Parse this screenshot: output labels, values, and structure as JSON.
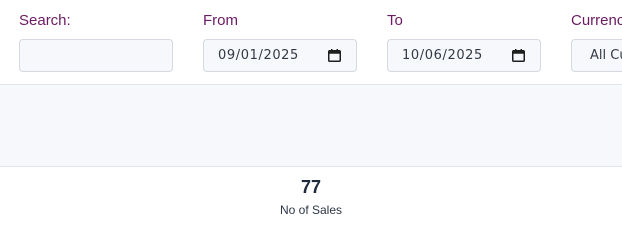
{
  "filters": {
    "search": {
      "label": "Search:",
      "value": ""
    },
    "from": {
      "label": "From",
      "value": "09/01/2025",
      "icon": "calendar-icon"
    },
    "to": {
      "label": "To",
      "value": "10/06/2025",
      "icon": "calendar-icon"
    },
    "currency": {
      "label": "Currency",
      "value": "All Currencies"
    }
  },
  "stats": {
    "sales_count": "77",
    "sales_label": "No of Sales"
  },
  "colors": {
    "label": "#6b1b63",
    "input_background": "#f6f8fb",
    "input_border": "#d6d9df",
    "band_background": "#f7f8fb",
    "stat_text": "#1f2a3d"
  }
}
